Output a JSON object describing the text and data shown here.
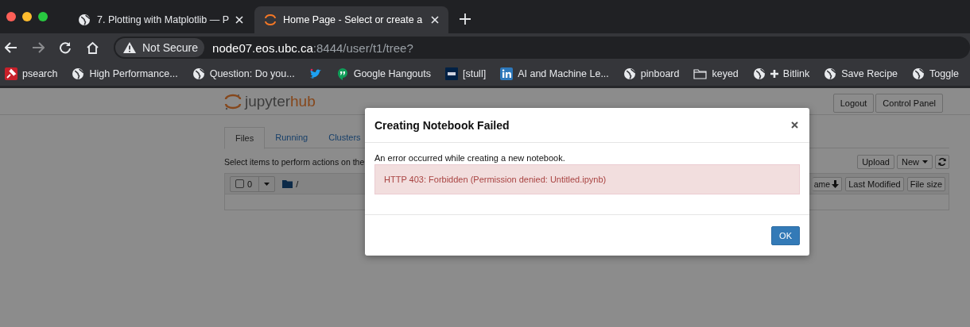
{
  "browser": {
    "tabs": [
      {
        "title": "7. Plotting with Matplotlib — P",
        "kind": "globe",
        "selected": false
      },
      {
        "title": "Home Page - Select or create a",
        "kind": "jupyter",
        "selected": true
      }
    ],
    "address": {
      "security": "Not Secure",
      "host": "node07.eos.ubc.ca",
      "path": ":8444/user/t1/tree?"
    },
    "bookmarks": [
      {
        "label": "psearch",
        "kind": "pin"
      },
      {
        "label": "High Performance...",
        "kind": "globe"
      },
      {
        "label": "Question: Do you...",
        "kind": "globe"
      },
      {
        "kind": "bird"
      },
      {
        "label": "Google Hangouts",
        "kind": "hangouts"
      },
      {
        "label": "[stull]",
        "kind": "ubc"
      },
      {
        "label": "AI and Machine Le...",
        "kind": "linkedin"
      },
      {
        "label": "pinboard",
        "kind": "globe"
      },
      {
        "label": "keyed",
        "kind": "folder"
      },
      {
        "label": "Bitlink",
        "kind": "globe-plus"
      },
      {
        "label": "Save Recipe",
        "kind": "globe"
      },
      {
        "label": "Toggle",
        "kind": "globe"
      }
    ]
  },
  "page": {
    "logo": {
      "text": "jupyter",
      "accent": "hub"
    },
    "header_buttons": [
      "Logout",
      "Control Panel"
    ],
    "tabs": [
      {
        "label": "Files",
        "selected": true
      },
      {
        "label": "Running",
        "selected": false
      },
      {
        "label": "Clusters",
        "selected": false
      }
    ],
    "hint": "Select items to perform actions on the",
    "actions": [
      {
        "label": "Upload",
        "kind": "button"
      },
      {
        "label": "New",
        "kind": "dropdown"
      },
      {
        "kind": "refresh"
      }
    ],
    "listing": {
      "all_checked": false,
      "selected_count": "0",
      "path": "/",
      "columns": [
        {
          "label": "ame",
          "kind": "sort"
        },
        {
          "label": "Last Modified",
          "kind": "plain"
        },
        {
          "label": "File size",
          "kind": "plain"
        }
      ]
    }
  },
  "dialog": {
    "title": "Creating Notebook Failed",
    "message": "An error occurred while creating a new notebook.",
    "error": "HTTP 403: Forbidden (Permission denied: Untitled.ipynb)",
    "button": "OK"
  }
}
